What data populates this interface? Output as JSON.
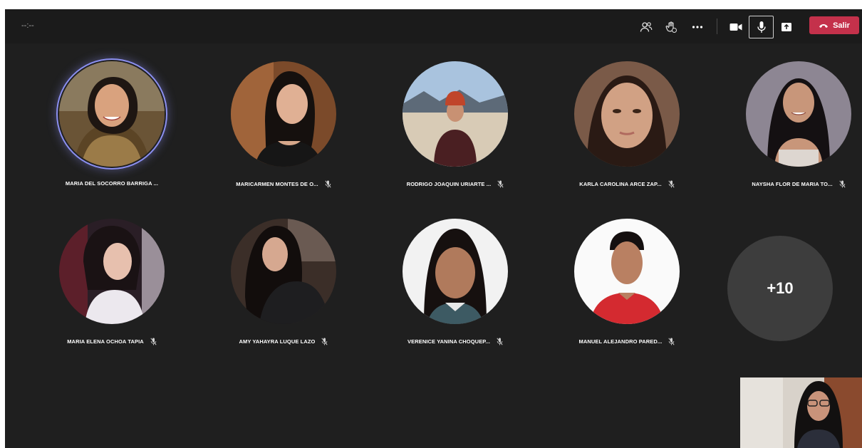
{
  "meeting": {
    "timer": "--:--"
  },
  "controls": {
    "participants_icon": "people-icon",
    "reactions_icon": "raise-hand-icon",
    "more_icon": "more-horizontal-icon",
    "camera_icon": "video-camera-icon",
    "mic_icon": "microphone-icon",
    "share_icon": "share-tray-icon",
    "leave_label": "Salir",
    "leave_color": "#c4314b"
  },
  "participants": [
    {
      "name": "MARIA DEL SOCORRO BARRIGA ..."
    },
    {
      "name": "MARICARMEN MONTES DE O..."
    },
    {
      "name": "RODRIGO JOAQUIN URIARTE ..."
    },
    {
      "name": "KARLA CAROLINA ARCE ZAP..."
    },
    {
      "name": "NAYSHA FLOR DE MARIA TO..."
    },
    {
      "name": "MARIA ELENA OCHOA TAPIA"
    },
    {
      "name": "AMY YAHAYRA LUQUE LAZO"
    },
    {
      "name": "VERENICE YANINA CHOQUEP..."
    },
    {
      "name": "MANUEL ALEJANDRO PARED..."
    }
  ],
  "overflow": {
    "label": "+10"
  },
  "colors": {
    "background": "#1f1f1f",
    "speaking_ring": "#8b8ff0"
  }
}
